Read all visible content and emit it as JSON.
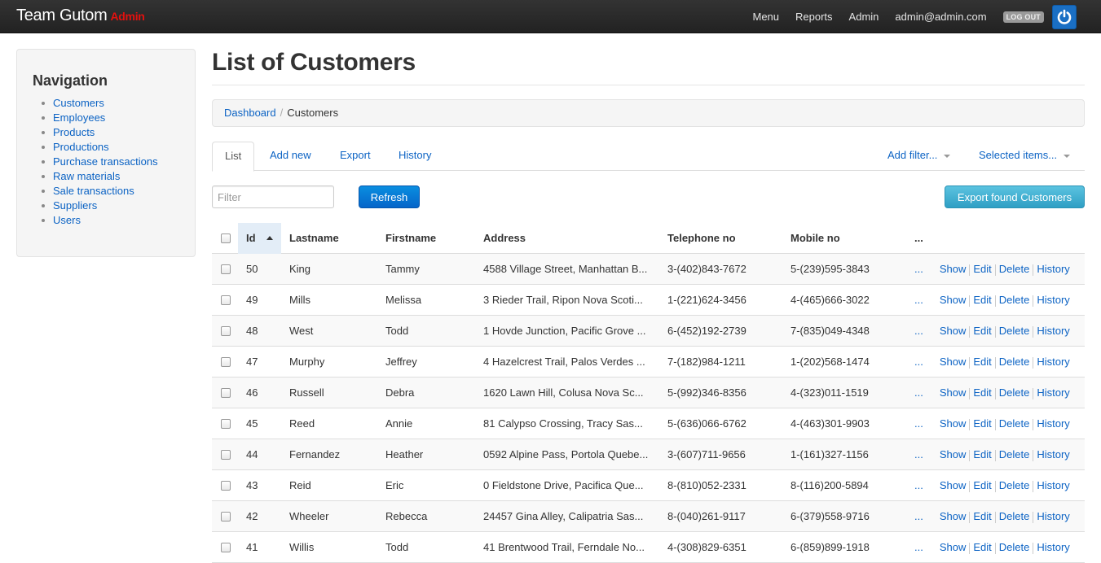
{
  "brand": {
    "name": "Team Gutom",
    "tag": "Admin"
  },
  "topnav": {
    "menu": "Menu",
    "reports": "Reports",
    "admin": "Admin",
    "user": "admin@admin.com",
    "logout": "LOG OUT",
    "power_icon": "power-icon"
  },
  "sidebar": {
    "title": "Navigation",
    "items": [
      {
        "label": "Customers"
      },
      {
        "label": "Employees"
      },
      {
        "label": "Products"
      },
      {
        "label": "Productions"
      },
      {
        "label": "Purchase transactions"
      },
      {
        "label": "Raw materials"
      },
      {
        "label": "Sale transactions"
      },
      {
        "label": "Suppliers"
      },
      {
        "label": "Users"
      }
    ]
  },
  "page": {
    "title": "List of Customers"
  },
  "breadcrumb": {
    "root": "Dashboard",
    "separator": "/",
    "current": "Customers"
  },
  "tabs": {
    "list": "List",
    "add_new": "Add new",
    "export": "Export",
    "history": "History",
    "add_filter": "Add filter...",
    "selected_items": "Selected items..."
  },
  "toolbar": {
    "filter_placeholder": "Filter",
    "refresh": "Refresh",
    "export_found": "Export found Customers"
  },
  "table": {
    "columns": {
      "id": "Id",
      "lastname": "Lastname",
      "firstname": "Firstname",
      "address": "Address",
      "telephone": "Telephone no",
      "mobile": "Mobile no",
      "more": "..."
    },
    "action_labels": {
      "more": "...",
      "show": "Show",
      "edit": "Edit",
      "delete": "Delete",
      "history": "History"
    },
    "rows": [
      {
        "id": "50",
        "lastname": "King",
        "firstname": "Tammy",
        "address": "4588 Village Street, Manhattan B...",
        "telephone": "3-(402)843-7672",
        "mobile": "5-(239)595-3843"
      },
      {
        "id": "49",
        "lastname": "Mills",
        "firstname": "Melissa",
        "address": "3 Rieder Trail, Ripon Nova Scoti...",
        "telephone": "1-(221)624-3456",
        "mobile": "4-(465)666-3022"
      },
      {
        "id": "48",
        "lastname": "West",
        "firstname": "Todd",
        "address": "1 Hovde Junction, Pacific Grove ...",
        "telephone": "6-(452)192-2739",
        "mobile": "7-(835)049-4348"
      },
      {
        "id": "47",
        "lastname": "Murphy",
        "firstname": "Jeffrey",
        "address": "4 Hazelcrest Trail, Palos Verdes ...",
        "telephone": "7-(182)984-1211",
        "mobile": "1-(202)568-1474"
      },
      {
        "id": "46",
        "lastname": "Russell",
        "firstname": "Debra",
        "address": "1620 Lawn Hill, Colusa Nova Sc...",
        "telephone": "5-(992)346-8356",
        "mobile": "4-(323)011-1519"
      },
      {
        "id": "45",
        "lastname": "Reed",
        "firstname": "Annie",
        "address": "81 Calypso Crossing, Tracy Sas...",
        "telephone": "5-(636)066-6762",
        "mobile": "4-(463)301-9903"
      },
      {
        "id": "44",
        "lastname": "Fernandez",
        "firstname": "Heather",
        "address": "0592 Alpine Pass, Portola Quebe...",
        "telephone": "3-(607)711-9656",
        "mobile": "1-(161)327-1156"
      },
      {
        "id": "43",
        "lastname": "Reid",
        "firstname": "Eric",
        "address": "0 Fieldstone Drive, Pacifica Que...",
        "telephone": "8-(810)052-2331",
        "mobile": "8-(116)200-5894"
      },
      {
        "id": "42",
        "lastname": "Wheeler",
        "firstname": "Rebecca",
        "address": "24457 Gina Alley, Calipatria Sas...",
        "telephone": "8-(040)261-9117",
        "mobile": "6-(379)558-9716"
      },
      {
        "id": "41",
        "lastname": "Willis",
        "firstname": "Todd",
        "address": "41 Brentwood Trail, Ferndale No...",
        "telephone": "4-(308)829-6351",
        "mobile": "6-(859)899-1918"
      }
    ]
  },
  "colors": {
    "navbar": "#222222",
    "link": "#0c63c4",
    "brand_tag": "#e3110f",
    "refresh_button": "#0565c9",
    "export_button": "#2f9fc4",
    "power_button": "#1a6fc4"
  }
}
